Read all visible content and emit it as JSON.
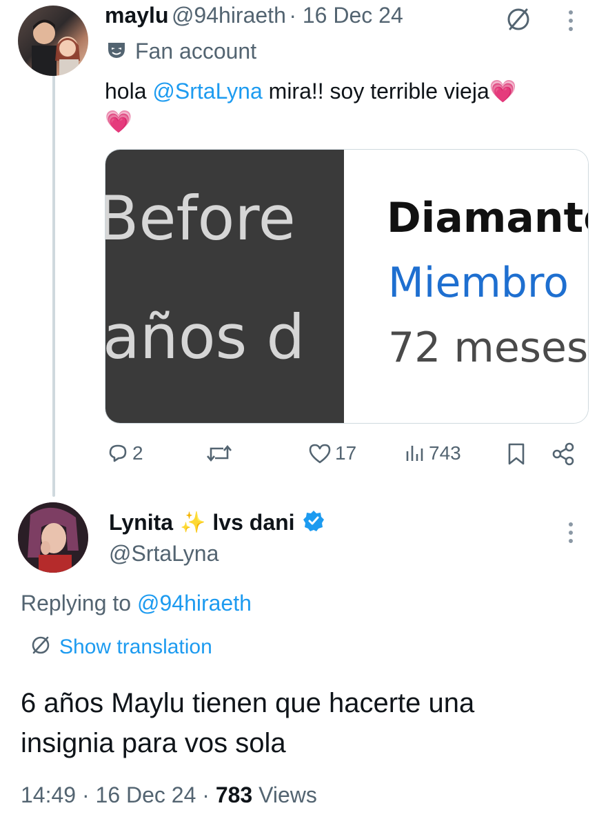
{
  "tweet1": {
    "display_name": "maylu",
    "handle": "@94hiraeth",
    "date": "· 16 Dec 24",
    "label": "Fan account",
    "text_before": "hola ",
    "mention": "@SrtaLyna",
    "text_after": " mira!! soy terrible vieja",
    "emoji": "💗",
    "media": {
      "left_line1": "Before",
      "left_line2": "años d",
      "right_line1": "Diamante",
      "right_line2": "Miembro",
      "right_line3": "72 meses"
    },
    "actions": {
      "replies": "2",
      "retweets": "",
      "likes": "17",
      "views": "743"
    }
  },
  "tweet2": {
    "display_name": "Lynita",
    "sparkle": "✨",
    "name_suffix": "lvs dani",
    "handle": "@SrtaLyna",
    "replying_prefix": "Replying to ",
    "replying_handle": "@94hiraeth",
    "show_translation": "Show translation",
    "text_line1": "6 años Maylu tienen que hacerte una",
    "text_line2": "insignia para vos sola",
    "time": "14:49",
    "date": "· 16 Dec 24 ·",
    "views_count": "783",
    "views_label": "Views"
  },
  "colors": {
    "accent": "#1d9bf0",
    "secondary": "#536471",
    "verified": "#1d9bf0"
  },
  "icons": [
    "globe-translate-icon",
    "more-icon",
    "fan-mask-icon",
    "reply-icon",
    "retweet-icon",
    "like-icon",
    "views-icon",
    "bookmark-icon",
    "share-icon",
    "verified-badge-icon"
  ]
}
